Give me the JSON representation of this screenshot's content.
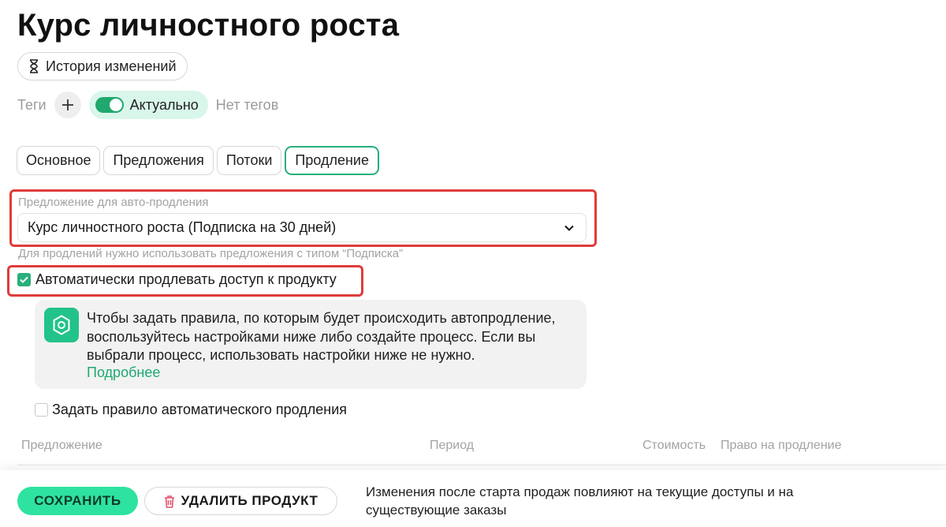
{
  "page": {
    "title": "Курс личностного роста"
  },
  "history_button": {
    "label": "История изменений",
    "icon": "hourglass-icon"
  },
  "tags": {
    "label": "Теги",
    "add_icon": "plus-icon",
    "status_label": "Актуально",
    "status_on": true,
    "empty_text": "Нет тегов"
  },
  "tabs": [
    {
      "label": "Основное",
      "active": false
    },
    {
      "label": "Предложения",
      "active": false
    },
    {
      "label": "Потоки",
      "active": false
    },
    {
      "label": "Продление",
      "active": true
    }
  ],
  "renewal": {
    "offer_label": "Предложение для авто-продления",
    "offer_value": "Курс личностного роста (Подписка на 30 дней)",
    "offer_hint": "Для продлений нужно использовать предложения с типом “Подписка”",
    "auto_renew_label": "Автоматически продлевать доступ к продукту",
    "auto_renew_checked": true,
    "info_text": "Чтобы задать правила, по которым будет происходить автопродление, воспользуйтесь настройками ниже либо создайте процесс. Если вы выбрали процесс, использовать настройки ниже не нужно.",
    "info_link": "Подробнее",
    "info_icon": "hexagon-icon",
    "rule_label": "Задать правило автоматического продления",
    "rule_checked": false
  },
  "table": {
    "columns": [
      "Предложение",
      "Период",
      "Стоимость",
      "Право на продление"
    ]
  },
  "footer": {
    "save_label": "СОХРАНИТЬ",
    "delete_label": "УДАЛИТЬ ПРОДУКТ",
    "delete_icon": "trash-icon",
    "note": "Изменения после старта продаж повлияют на текущие доступы и на существующие заказы"
  },
  "colors": {
    "accent": "#27b07a",
    "save_button": "#2ee39f",
    "highlight_box": "#e03b3b",
    "info_icon_bg": "#22c38a"
  }
}
